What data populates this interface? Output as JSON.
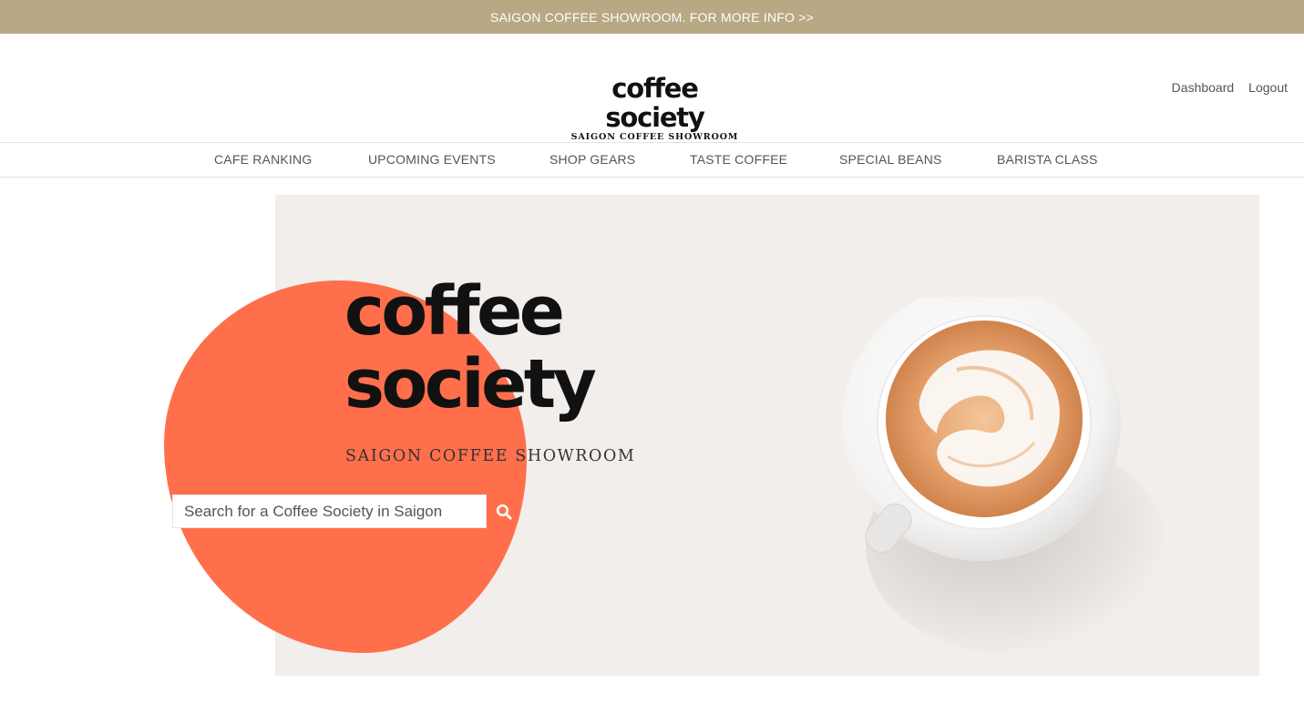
{
  "promo": {
    "text": "SAIGON COFFEE SHOWROOM. FOR MORE INFO >>"
  },
  "brand": {
    "name": "coffee society",
    "tagline": "SAIGON COFFEE SHOWROOM"
  },
  "account": {
    "dashboard": "Dashboard",
    "logout": "Logout"
  },
  "nav": {
    "items": [
      {
        "label": "CAFE RANKING"
      },
      {
        "label": "UPCOMING EVENTS"
      },
      {
        "label": "SHOP GEARS"
      },
      {
        "label": "TASTE COFFEE"
      },
      {
        "label": "SPECIAL BEANS"
      },
      {
        "label": "BARISTA CLASS"
      }
    ]
  },
  "hero": {
    "title_line1": "coffee",
    "title_line2": "society",
    "subtitle": "SAIGON COFFEE SHOWROOM"
  },
  "search": {
    "placeholder": "Search for a Coffee Society in Saigon",
    "value": ""
  },
  "icons": {
    "search": "search-icon",
    "coffee_cup": "coffee-cup-image"
  },
  "colors": {
    "promo_bg": "#b8a883",
    "accent_blob": "#ff6f4c",
    "hero_bg": "#f1eeeb",
    "nav_text": "#555555"
  }
}
